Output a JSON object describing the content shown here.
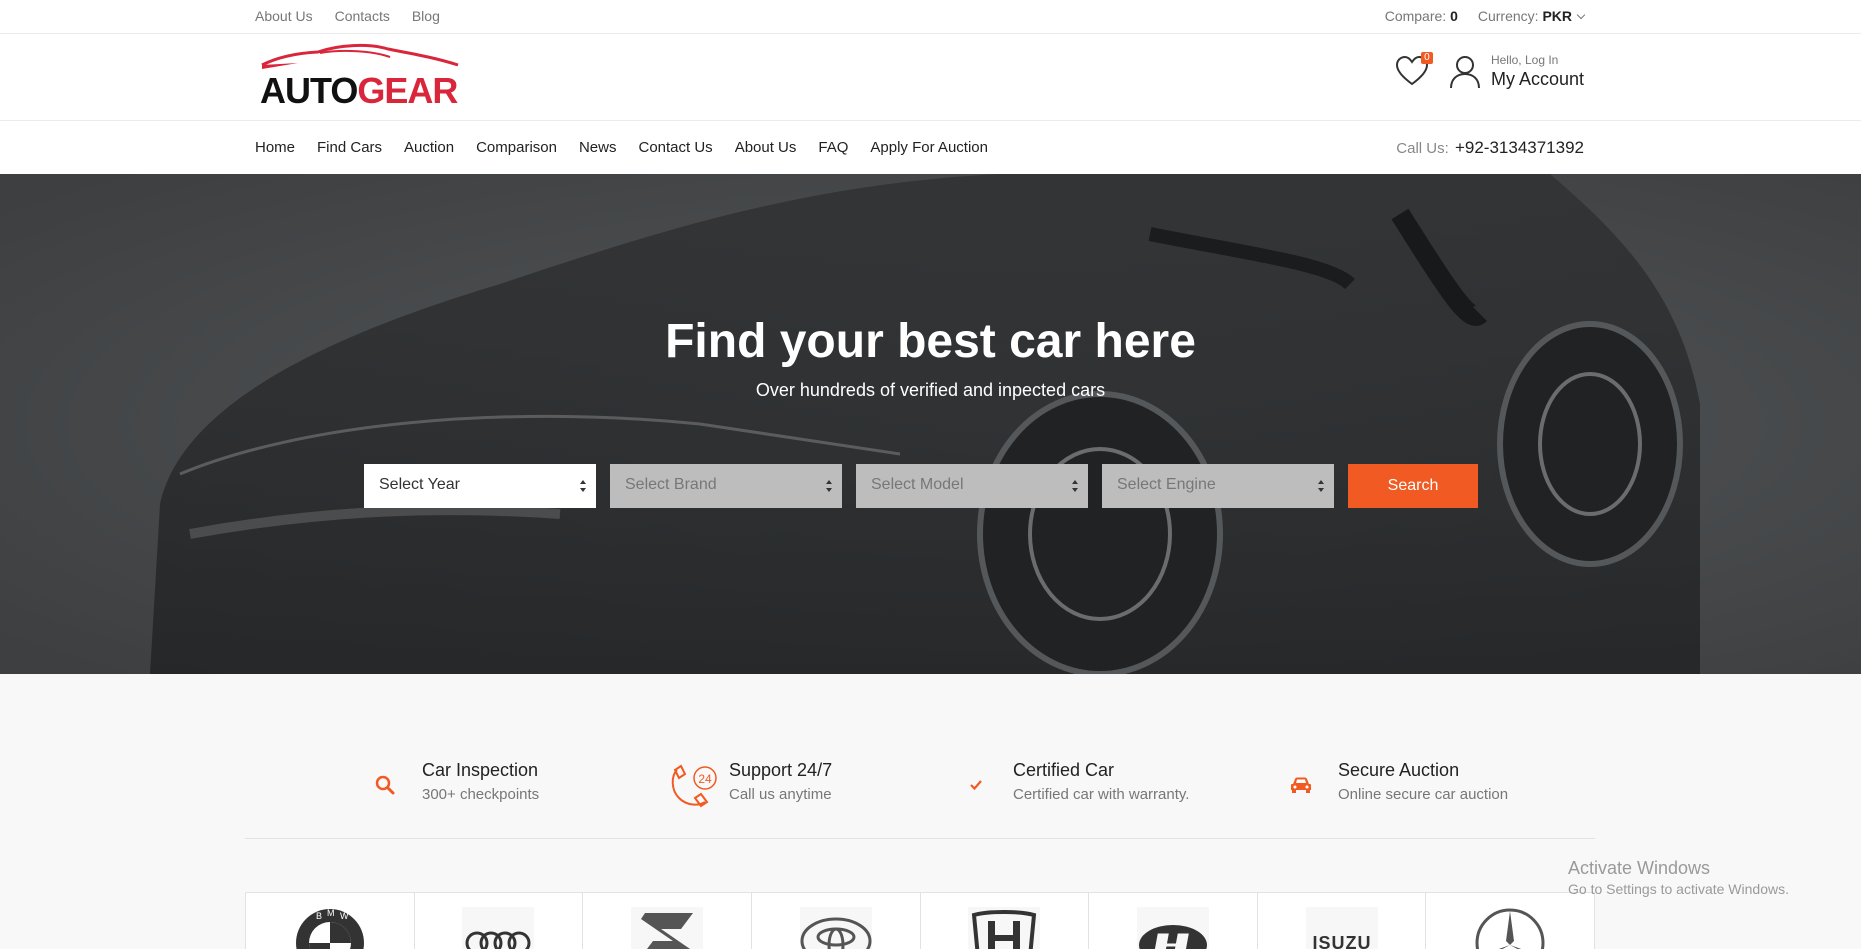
{
  "topbar": {
    "links": [
      "About Us",
      "Contacts",
      "Blog"
    ],
    "compare_label": "Compare:",
    "compare_count": "0",
    "currency_label": "Currency:",
    "currency_value": "PKR"
  },
  "header": {
    "logo_text_dark": "AUTO",
    "logo_text_red": "GEAR",
    "wishlist_count": "0",
    "account_greeting": "Hello, Log In",
    "account_label": "My Account"
  },
  "nav": {
    "items": [
      "Home",
      "Find Cars",
      "Auction",
      "Comparison",
      "News",
      "Contact Us",
      "About Us",
      "FAQ",
      "Apply For Auction"
    ],
    "call_label": "Call Us:",
    "call_number": "+92-3134371392"
  },
  "hero": {
    "title": "Find your best car here",
    "subtitle": "Over hundreds of verified and inpected cars",
    "filters": [
      "Select Year",
      "Select Brand",
      "Select Model",
      "Select Engine"
    ],
    "search_label": "Search"
  },
  "features": [
    {
      "icon": "search-icon",
      "title": "Car Inspection",
      "desc": "300+ checkpoints"
    },
    {
      "icon": "support-24-icon",
      "title": "Support 24/7",
      "desc": "Call us anytime"
    },
    {
      "icon": "check-icon",
      "title": "Certified Car",
      "desc": "Certified car with warranty."
    },
    {
      "icon": "car-icon",
      "title": "Secure Auction",
      "desc": "Online secure car auction"
    }
  ],
  "brands": [
    "bmw-logo",
    "audi-logo",
    "suzuki-logo",
    "toyota-logo",
    "honda-logo",
    "hyundai-logo",
    "isuzu-logo",
    "mercedes-logo"
  ],
  "brand_texts": {
    "isuzu": "ISUZU"
  },
  "colors": {
    "accent": "#f15a22",
    "logo_red": "#d9263a"
  },
  "watermark": {
    "line1": "Activate Windows",
    "line2": "Go to Settings to activate Windows."
  }
}
